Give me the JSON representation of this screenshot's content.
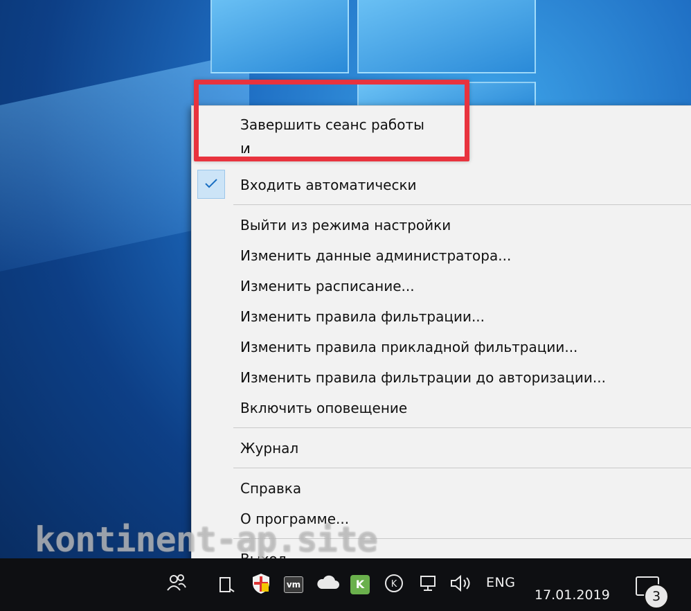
{
  "context_menu": {
    "items": [
      {
        "label": "Завершить сеанс работы"
      },
      {
        "label": "И"
      },
      {
        "label": "Входить автоматически",
        "checked": true
      },
      {
        "label": "Выйти из режима настройки"
      },
      {
        "label": "Изменить данные администратора..."
      },
      {
        "label": "Изменить расписание..."
      },
      {
        "label": "Изменить правила фильтрации..."
      },
      {
        "label": "Изменить правила прикладной фильтрации..."
      },
      {
        "label": "Изменить правила фильтрации до авторизации..."
      },
      {
        "label": "Включить оповещение"
      },
      {
        "label": "Журнал"
      },
      {
        "label": "Справка"
      },
      {
        "label": "О программе..."
      },
      {
        "label": "Выход"
      }
    ]
  },
  "taskbar": {
    "language": "ENG",
    "date": "17.01.2019",
    "notification_count": "3",
    "icons": [
      "people-icon",
      "antivirus-icon",
      "security-shield-icon",
      "vm-icon",
      "cloud-icon",
      "kaspersky-icon",
      "k-icon",
      "network-icon",
      "volume-icon"
    ]
  },
  "watermark": "kontinent-ap.site",
  "colors": {
    "highlight": "#e8333e",
    "menu_bg": "#f2f2f2",
    "check_bg": "#cce4f7",
    "taskbar_bg": "#0e0f12"
  }
}
